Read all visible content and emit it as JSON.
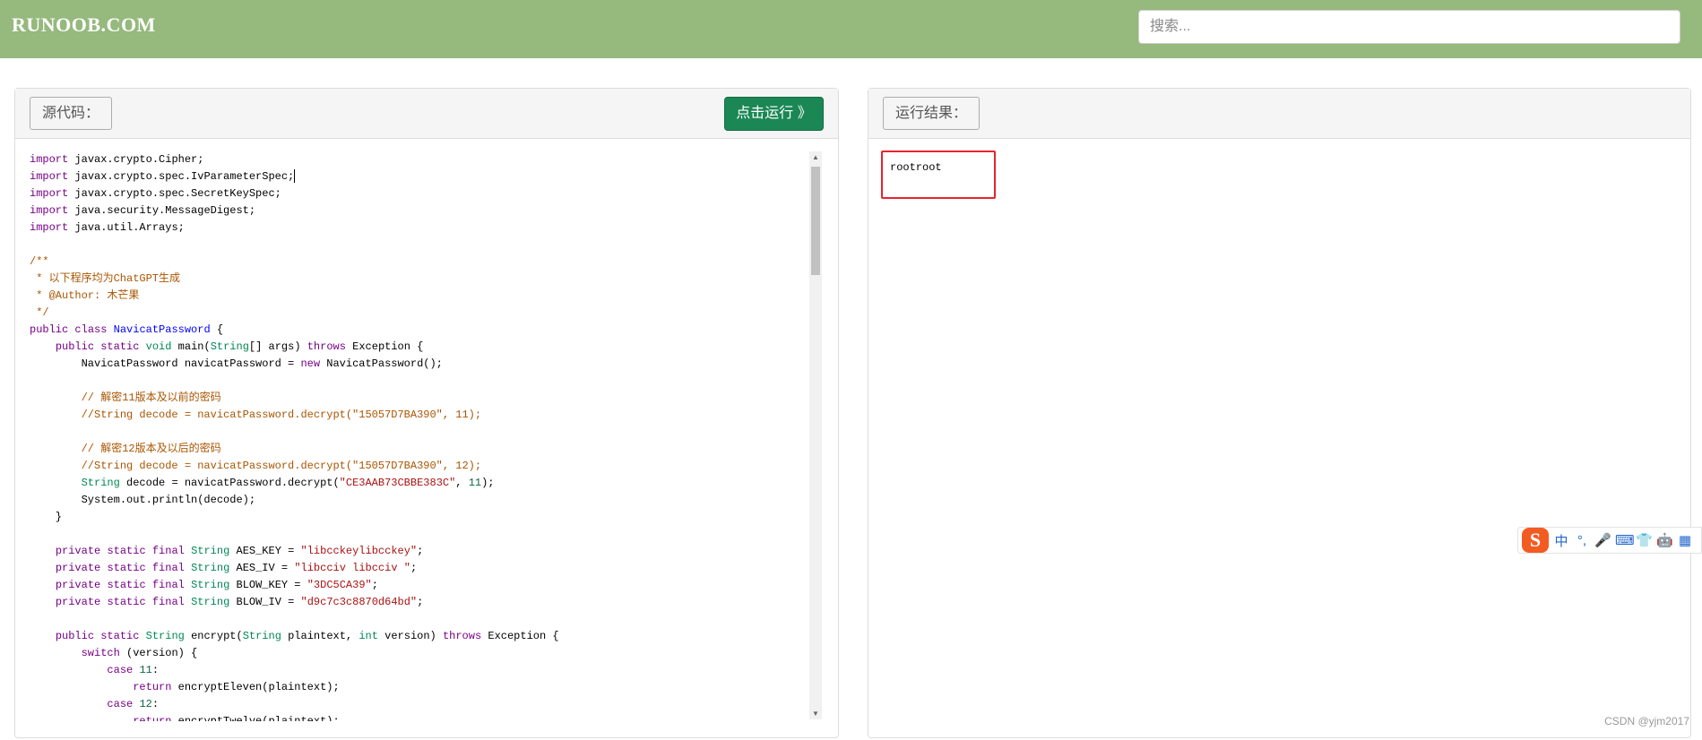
{
  "header": {
    "logo": "RUNOOB.COM",
    "search_placeholder": "搜索..."
  },
  "editor_panel": {
    "label": "源代码：",
    "run_button": "点击运行 》",
    "code_lines": [
      [
        [
          "kw",
          "import"
        ],
        [
          "p",
          " javax.crypto.Cipher;"
        ]
      ],
      [
        [
          "kw",
          "import"
        ],
        [
          "p",
          " javax.crypto.spec.IvParameterSpec;"
        ],
        [
          "cursor",
          ""
        ]
      ],
      [
        [
          "kw",
          "import"
        ],
        [
          "p",
          " javax.crypto.spec.SecretKeySpec;"
        ]
      ],
      [
        [
          "kw",
          "import"
        ],
        [
          "p",
          " java.security.MessageDigest;"
        ]
      ],
      [
        [
          "kw",
          "import"
        ],
        [
          "p",
          " java.util.Arrays;"
        ]
      ],
      [],
      [
        [
          "cm",
          "/**"
        ]
      ],
      [
        [
          "cm",
          " * 以下程序均为ChatGPT生成"
        ]
      ],
      [
        [
          "cm",
          " * @Author: 木芒果"
        ]
      ],
      [
        [
          "cm",
          " */"
        ]
      ],
      [
        [
          "kw",
          "public"
        ],
        [
          "p",
          " "
        ],
        [
          "kw",
          "class"
        ],
        [
          "p",
          " "
        ],
        [
          "def",
          "NavicatPassword"
        ],
        [
          "p",
          " {"
        ]
      ],
      [
        [
          "p",
          "    "
        ],
        [
          "kw",
          "public"
        ],
        [
          "p",
          " "
        ],
        [
          "kw",
          "static"
        ],
        [
          "p",
          " "
        ],
        [
          "ty",
          "void"
        ],
        [
          "p",
          " main("
        ],
        [
          "ty",
          "String"
        ],
        [
          "p",
          "[] args) "
        ],
        [
          "kw",
          "throws"
        ],
        [
          "p",
          " Exception {"
        ]
      ],
      [
        [
          "p",
          "        NavicatPassword navicatPassword = "
        ],
        [
          "kw",
          "new"
        ],
        [
          "p",
          " NavicatPassword();"
        ]
      ],
      [],
      [
        [
          "p",
          "        "
        ],
        [
          "cm",
          "// 解密11版本及以前的密码"
        ]
      ],
      [
        [
          "p",
          "        "
        ],
        [
          "cm",
          "//String decode = navicatPassword.decrypt(\"15057D7BA390\", 11);"
        ]
      ],
      [],
      [
        [
          "p",
          "        "
        ],
        [
          "cm",
          "// 解密12版本及以后的密码"
        ]
      ],
      [
        [
          "p",
          "        "
        ],
        [
          "cm",
          "//String decode = navicatPassword.decrypt(\"15057D7BA390\", 12);"
        ]
      ],
      [
        [
          "p",
          "        "
        ],
        [
          "ty",
          "String"
        ],
        [
          "p",
          " decode = navicatPassword.decrypt("
        ],
        [
          "str",
          "\"CE3AAB73CBBE383C\""
        ],
        [
          "p",
          ", "
        ],
        [
          "num",
          "11"
        ],
        [
          "p",
          ");"
        ]
      ],
      [
        [
          "p",
          "        System.out.println(decode);"
        ]
      ],
      [
        [
          "p",
          "    }"
        ]
      ],
      [],
      [
        [
          "p",
          "    "
        ],
        [
          "kw",
          "private"
        ],
        [
          "p",
          " "
        ],
        [
          "kw",
          "static"
        ],
        [
          "p",
          " "
        ],
        [
          "kw",
          "final"
        ],
        [
          "p",
          " "
        ],
        [
          "ty",
          "String"
        ],
        [
          "p",
          " AES_KEY = "
        ],
        [
          "str",
          "\"libcckeylibcckey\""
        ],
        [
          "p",
          ";"
        ]
      ],
      [
        [
          "p",
          "    "
        ],
        [
          "kw",
          "private"
        ],
        [
          "p",
          " "
        ],
        [
          "kw",
          "static"
        ],
        [
          "p",
          " "
        ],
        [
          "kw",
          "final"
        ],
        [
          "p",
          " "
        ],
        [
          "ty",
          "String"
        ],
        [
          "p",
          " AES_IV = "
        ],
        [
          "str",
          "\"libcciv libcciv \""
        ],
        [
          "p",
          ";"
        ]
      ],
      [
        [
          "p",
          "    "
        ],
        [
          "kw",
          "private"
        ],
        [
          "p",
          " "
        ],
        [
          "kw",
          "static"
        ],
        [
          "p",
          " "
        ],
        [
          "kw",
          "final"
        ],
        [
          "p",
          " "
        ],
        [
          "ty",
          "String"
        ],
        [
          "p",
          " BLOW_KEY = "
        ],
        [
          "str",
          "\"3DC5CA39\""
        ],
        [
          "p",
          ";"
        ]
      ],
      [
        [
          "p",
          "    "
        ],
        [
          "kw",
          "private"
        ],
        [
          "p",
          " "
        ],
        [
          "kw",
          "static"
        ],
        [
          "p",
          " "
        ],
        [
          "kw",
          "final"
        ],
        [
          "p",
          " "
        ],
        [
          "ty",
          "String"
        ],
        [
          "p",
          " BLOW_IV = "
        ],
        [
          "str",
          "\"d9c7c3c8870d64bd\""
        ],
        [
          "p",
          ";"
        ]
      ],
      [],
      [
        [
          "p",
          "    "
        ],
        [
          "kw",
          "public"
        ],
        [
          "p",
          " "
        ],
        [
          "kw",
          "static"
        ],
        [
          "p",
          " "
        ],
        [
          "ty",
          "String"
        ],
        [
          "p",
          " encrypt("
        ],
        [
          "ty",
          "String"
        ],
        [
          "p",
          " plaintext, "
        ],
        [
          "ty",
          "int"
        ],
        [
          "p",
          " version) "
        ],
        [
          "kw",
          "throws"
        ],
        [
          "p",
          " Exception {"
        ]
      ],
      [
        [
          "p",
          "        "
        ],
        [
          "kw",
          "switch"
        ],
        [
          "p",
          " (version) {"
        ]
      ],
      [
        [
          "p",
          "            "
        ],
        [
          "kw",
          "case"
        ],
        [
          "p",
          " "
        ],
        [
          "num",
          "11"
        ],
        [
          "p",
          ":"
        ]
      ],
      [
        [
          "p",
          "                "
        ],
        [
          "kw",
          "return"
        ],
        [
          "p",
          " encryptEleven(plaintext);"
        ]
      ],
      [
        [
          "p",
          "            "
        ],
        [
          "kw",
          "case"
        ],
        [
          "p",
          " "
        ],
        [
          "num",
          "12"
        ],
        [
          "p",
          ":"
        ]
      ],
      [
        [
          "p",
          "                "
        ],
        [
          "kw",
          "return"
        ],
        [
          "p",
          " encryptTwelve(plaintext);"
        ]
      ]
    ]
  },
  "result_panel": {
    "label": "运行结果：",
    "output": "rootroot"
  },
  "ime_toolbar": {
    "logo": "S",
    "items": [
      "中",
      "°,",
      "🎤",
      "⌨",
      "👕",
      "🤖",
      "▦"
    ]
  },
  "watermark": "CSDN @yjm2017",
  "colors": {
    "header_bg": "#96b97d",
    "run_button": "#1a8754",
    "result_highlight": "#e8242c"
  }
}
